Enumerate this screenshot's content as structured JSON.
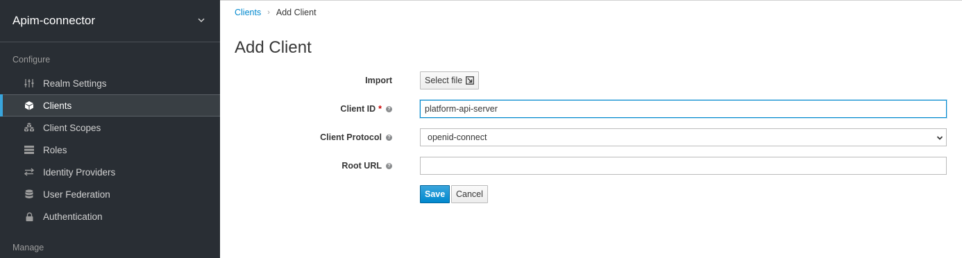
{
  "sidebar": {
    "realm_name": "Apim-connector",
    "configure_title": "Configure",
    "manage_title": "Manage",
    "items": [
      {
        "label": "Realm Settings",
        "icon": "sliders-icon"
      },
      {
        "label": "Clients",
        "icon": "cube-icon",
        "active": true
      },
      {
        "label": "Client Scopes",
        "icon": "cubes-icon"
      },
      {
        "label": "Roles",
        "icon": "list-icon"
      },
      {
        "label": "Identity Providers",
        "icon": "exchange-icon"
      },
      {
        "label": "User Federation",
        "icon": "database-icon"
      },
      {
        "label": "Authentication",
        "icon": "lock-icon"
      }
    ]
  },
  "breadcrumb": {
    "parent": "Clients",
    "separator": "›",
    "current": "Add Client"
  },
  "page": {
    "title": "Add Client"
  },
  "form": {
    "import_label": "Import",
    "select_file_label": "Select file",
    "client_id_label": "Client ID",
    "required_mark": "*",
    "client_id_value": "platform-api-server",
    "client_protocol_label": "Client Protocol",
    "client_protocol_value": "openid-connect",
    "root_url_label": "Root URL",
    "root_url_value": "",
    "help_glyph": "?",
    "save_label": "Save",
    "cancel_label": "Cancel"
  },
  "colors": {
    "sidebar_bg": "#292e34",
    "accent": "#0088ce",
    "active_indicator": "#39a5dc",
    "required": "#cc0000"
  }
}
